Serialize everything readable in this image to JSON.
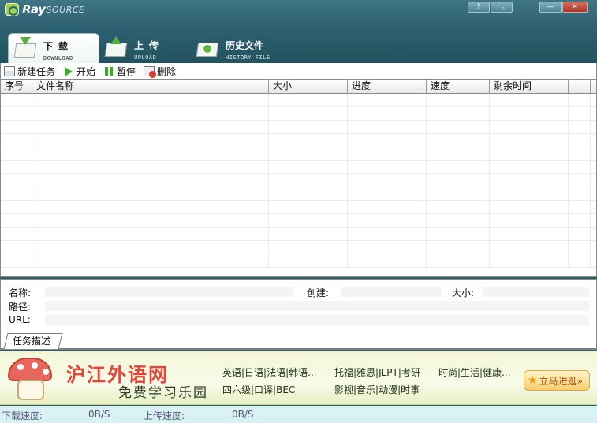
{
  "app": {
    "logo_main": "Ray",
    "logo_sub": "SOURCE"
  },
  "window_buttons": {
    "help": "?",
    "minimize": "—",
    "close": "✕"
  },
  "tabs": [
    {
      "cn": "下载",
      "en": "DOWNLOAD",
      "icon": "download-tray-icon"
    },
    {
      "cn": "上传",
      "en": "UPLOAD",
      "icon": "upload-tray-icon"
    },
    {
      "cn": "历史文件",
      "en": "HISTORY FILE",
      "icon": "history-tray-icon"
    }
  ],
  "toolbar": {
    "new_task": "新建任务",
    "start": "开始",
    "pause": "暂停",
    "delete": "删除"
  },
  "table": {
    "columns": [
      "序号",
      "文件名称",
      "大小",
      "进度",
      "速度",
      "剩余时间"
    ],
    "rows": []
  },
  "detail": {
    "name_label": "名称:",
    "created_label": "创建:",
    "size_label": "大小:",
    "path_label": "路径:",
    "url_label": "URL:",
    "tab_label": "任务描述"
  },
  "banner": {
    "brand_name": "沪江外语网",
    "slogan": "免费学习乐园",
    "links_row1": [
      "英语|日语|法语|韩语...",
      "托福|雅思|JLPT|考研",
      "时尚|生活|健康..."
    ],
    "links_row2": [
      "四六级|口译|BEC",
      "影视|音乐|动漫|时事"
    ],
    "enter_label": "立马进逛»"
  },
  "status": {
    "download_label": "下载速度:",
    "download_value": "0B/S",
    "upload_label": "上传速度:",
    "upload_value": "0B/S"
  },
  "colors": {
    "header": "#2c6070",
    "accent_green": "#3da92f",
    "brand_red": "#e3453a",
    "status_bg": "#d8f1f2"
  }
}
